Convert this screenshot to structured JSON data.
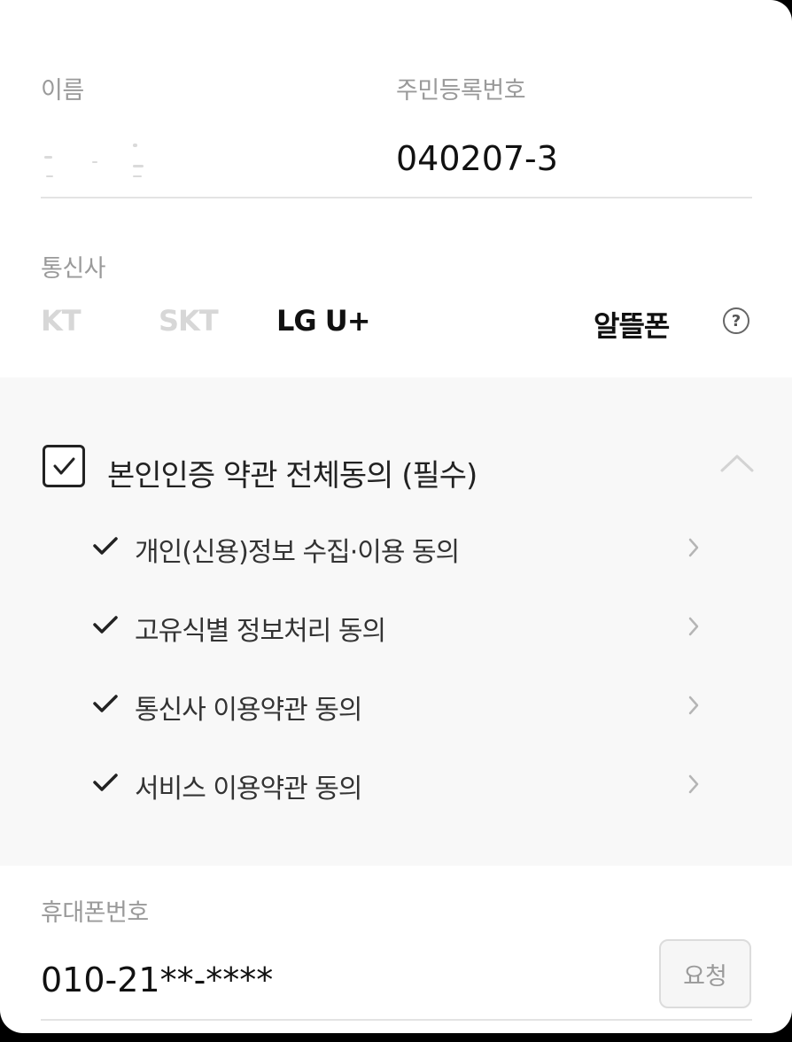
{
  "form": {
    "name_label": "이름",
    "rrn_label": "주민등록번호",
    "rrn_value": "040207-3",
    "carrier_label": "통신사",
    "phone_label": "휴대폰번호",
    "phone_value": "010-21**-****",
    "request_label": "요청"
  },
  "carriers": [
    {
      "label": "KT",
      "selected": false
    },
    {
      "label": "SKT",
      "selected": false
    },
    {
      "label": "LG U+",
      "selected": true
    },
    {
      "label": "알뜰폰",
      "selected": true
    }
  ],
  "terms": {
    "all_label": "본인인증 약관 전체동의 (필수)",
    "all_checked": true,
    "items": [
      {
        "label": "개인(신용)정보 수집·이용 동의",
        "checked": true
      },
      {
        "label": "고유식별 정보처리 동의",
        "checked": true
      },
      {
        "label": "통신사 이용약관 동의",
        "checked": true
      },
      {
        "label": "서비스 이용약관 동의",
        "checked": true
      }
    ]
  },
  "icons": {
    "help": "question-circle-icon",
    "collapse": "chevron-up-icon",
    "check": "check-icon",
    "arrow": "chevron-right-icon"
  },
  "colors": {
    "label_gray": "#9a9a9a",
    "text_dark": "#111111",
    "terms_bg": "#f8f8f8",
    "carrier_unselected": "#d7d7d7"
  }
}
